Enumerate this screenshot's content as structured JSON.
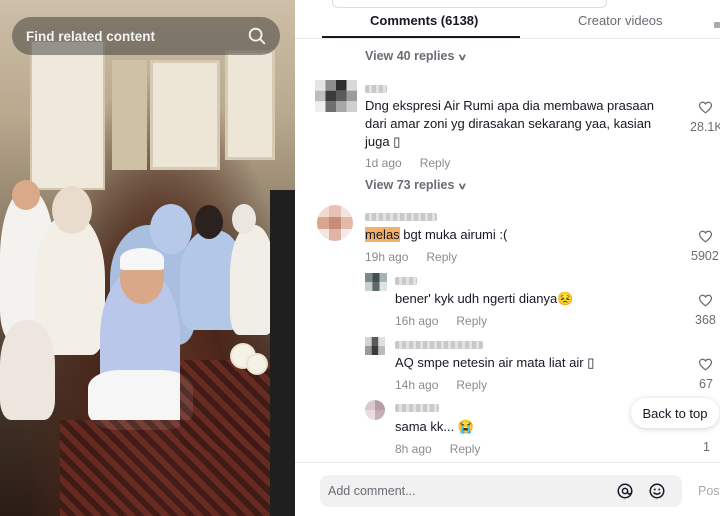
{
  "video": {
    "search_placeholder": "Find related content",
    "search_icon": "search-icon"
  },
  "tabs": {
    "comments_label": "Comments (6138)",
    "creator_label": "Creator videos"
  },
  "threads": [
    {
      "view_replies": "View 40 replies"
    },
    {
      "text_line1": "Dng ekspresi Air Rumi apa dia membawa prasaan",
      "text_line2": "dari amar zoni yg dirasakan sekarang yaa, kasian",
      "text_line3": "juga ▯",
      "time": "1d ago",
      "reply_label": "Reply",
      "likes": "28.1K",
      "view_replies": "View 73 replies"
    },
    {
      "text_highlight": "melas",
      "text_rest": " bgt muka airumi :(",
      "time": "19h ago",
      "reply_label": "Reply",
      "likes": "5902"
    }
  ],
  "replies": [
    {
      "text": "bener' kyk udh ngerti dianya😣",
      "time": "16h ago",
      "reply_label": "Reply",
      "likes": "368"
    },
    {
      "text": "AQ smpe netesin air mata liat air ▯",
      "time": "14h ago",
      "reply_label": "Reply",
      "likes": "67"
    },
    {
      "text": "sama kk... 😭",
      "time": "8h ago",
      "reply_label": "Reply",
      "likes": "1"
    }
  ],
  "back_to_top": "Back to top",
  "footer": {
    "placeholder": "Add comment...",
    "post_label": "Post"
  },
  "colors": {
    "highlight": "#f4b06b",
    "text_primary": "#161823",
    "text_secondary": "#8a8b91"
  }
}
